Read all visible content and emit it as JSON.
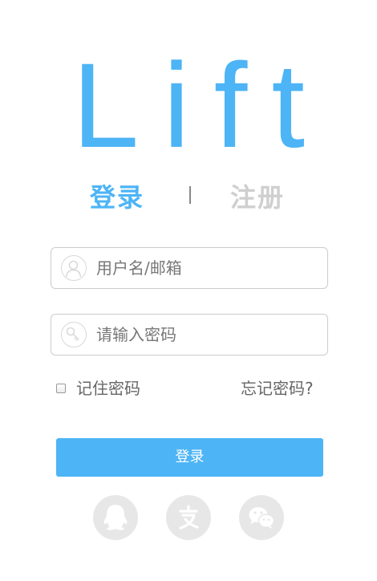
{
  "logo": {
    "text": "Lift",
    "color": "#4db4f6"
  },
  "tabs": {
    "login_label": "登录",
    "register_label": "注册",
    "active_color": "#4db4f6",
    "inactive_color": "#cfcfcf"
  },
  "form": {
    "username": {
      "placeholder": "用户名/邮箱",
      "value": "",
      "icon": "user-icon"
    },
    "password": {
      "placeholder": "请输入密码",
      "value": "",
      "icon": "key-icon"
    },
    "remember_label": "记住密码",
    "remember_checked": false,
    "forgot_label": "忘记密码?",
    "submit_label": "登录"
  },
  "social": [
    {
      "icon": "qq-icon"
    },
    {
      "icon": "alipay-icon"
    },
    {
      "icon": "wechat-icon"
    }
  ]
}
